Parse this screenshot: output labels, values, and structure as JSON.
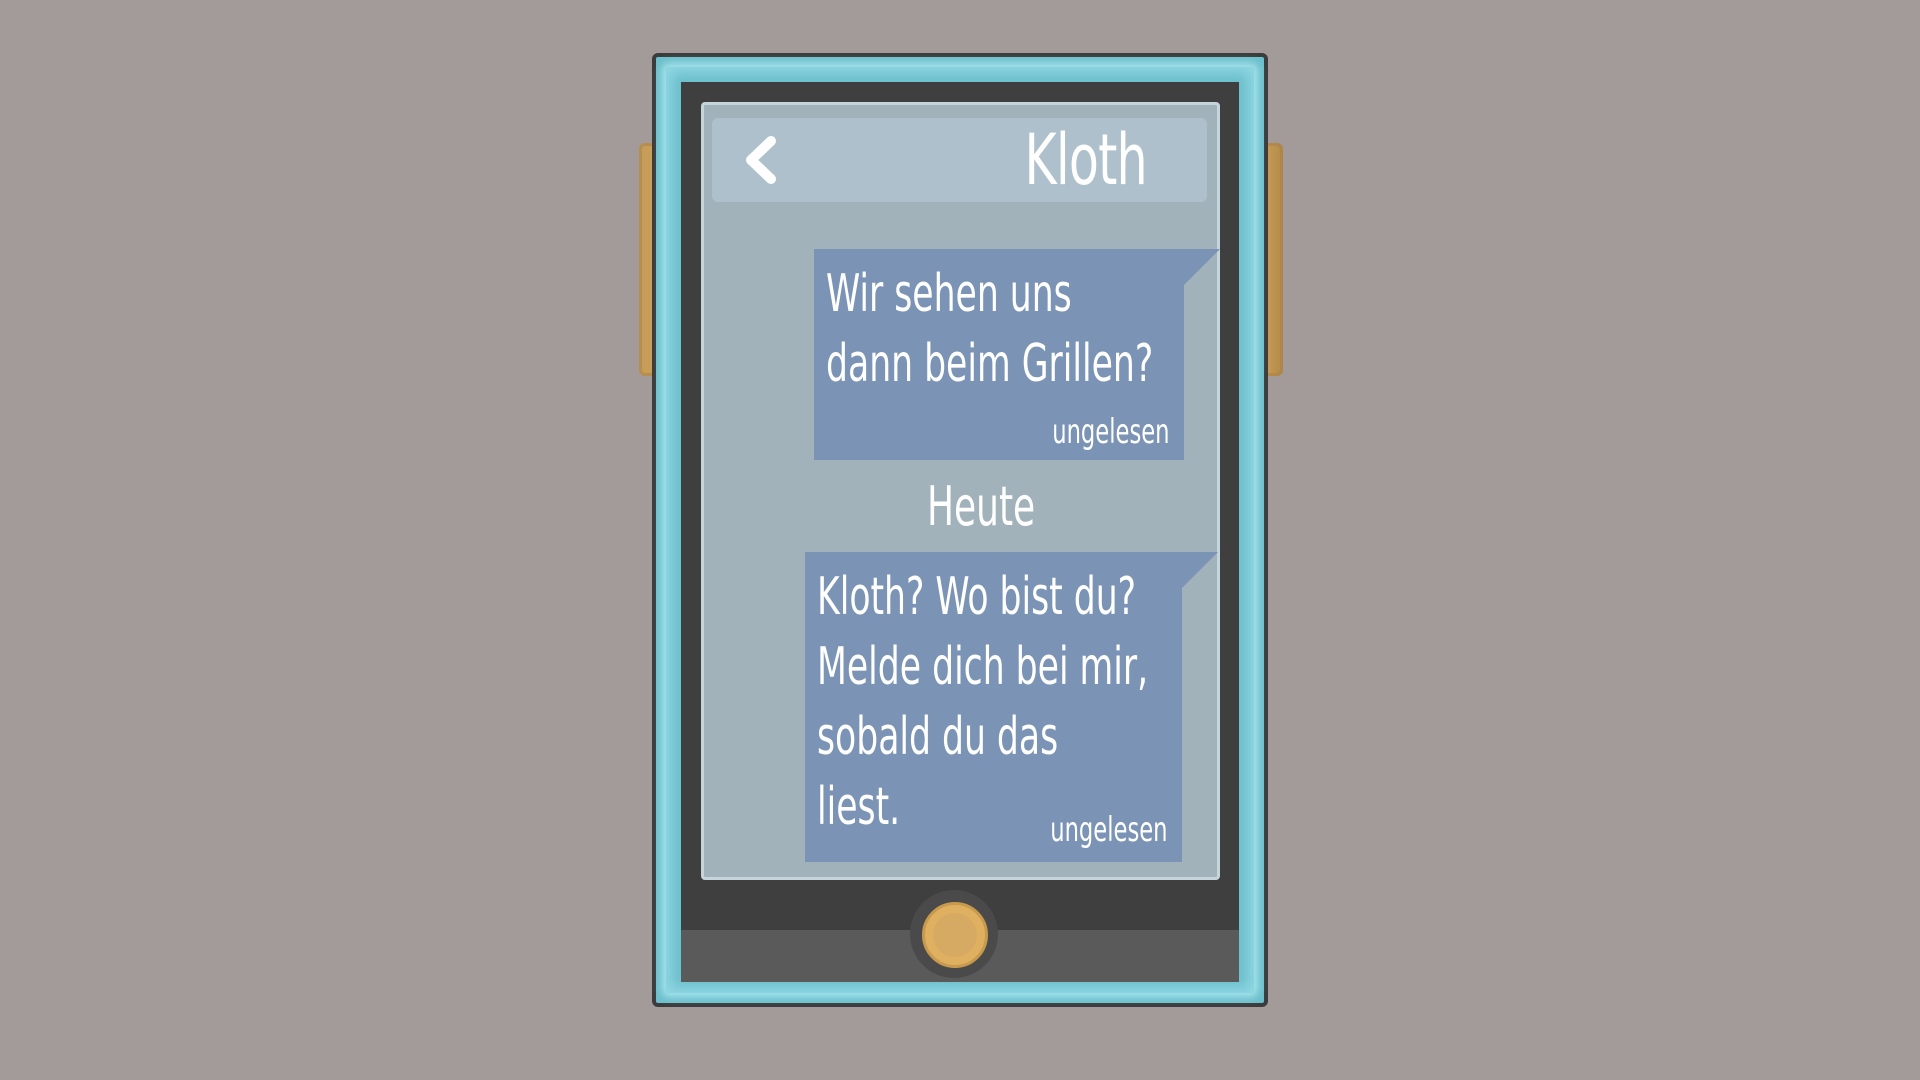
{
  "chat": {
    "contact_name": "Kloth",
    "back_icon": "chevron-left-icon",
    "messages": [
      {
        "lines": [
          "Wir sehen uns",
          "dann beim Grillen?"
        ],
        "status": "ungelesen"
      },
      {
        "lines": [
          "Kloth? Wo bist du?",
          "Melde dich bei mir,",
          "sobald du das",
          "liest."
        ],
        "status": "ungelesen"
      }
    ],
    "day_separator": "Heute"
  },
  "colors": {
    "background": "#a39b99",
    "frame": "#6cbfcc",
    "bubble": "#7b93b4",
    "home_button": "#e0b061"
  }
}
